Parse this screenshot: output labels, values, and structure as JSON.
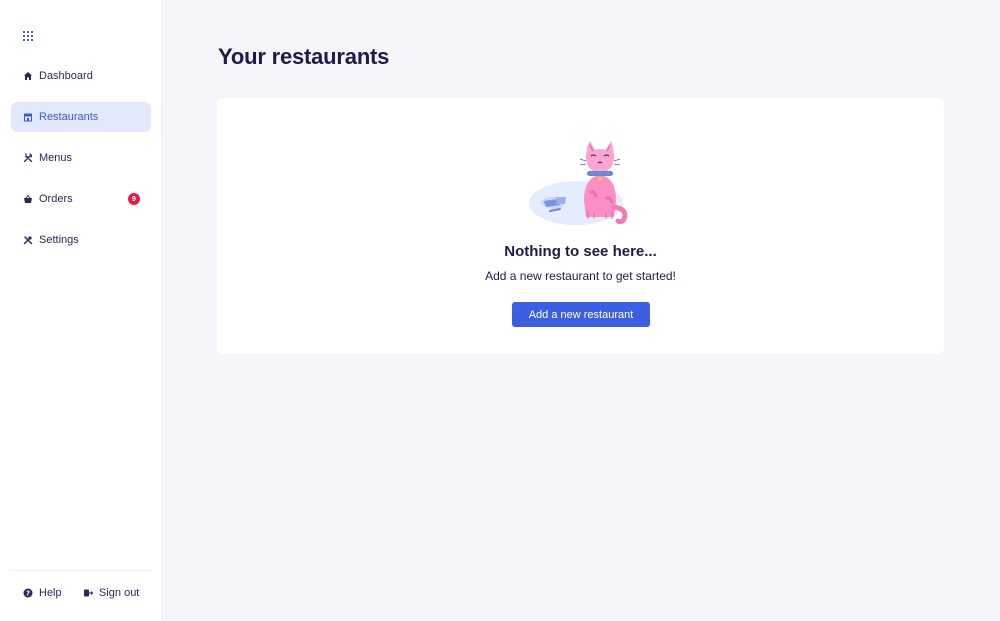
{
  "sidebar": {
    "logo_icon": "grid-icon",
    "items": [
      {
        "label": "Dashboard",
        "icon": "home-icon",
        "active": false
      },
      {
        "label": "Restaurants",
        "icon": "storefront-icon",
        "active": true
      },
      {
        "label": "Menus",
        "icon": "utensils-icon",
        "active": false
      },
      {
        "label": "Orders",
        "icon": "basket-icon",
        "active": false,
        "badge": "9"
      },
      {
        "label": "Settings",
        "icon": "tools-icon",
        "active": false
      }
    ],
    "footer": {
      "help_label": "Help",
      "signout_label": "Sign out"
    }
  },
  "main": {
    "title": "Your restaurants",
    "empty_state": {
      "illustration": "sad-cat-illustration",
      "title": "Nothing to see here...",
      "subtitle": "Add a new restaurant to get started!",
      "button_label": "Add a new restaurant"
    }
  },
  "colors": {
    "accent": "#3b5fe0",
    "active_bg": "#e3e8fd",
    "badge": "#e11d48",
    "page_bg": "#f5f6fb",
    "text": "#1e1b4b"
  }
}
